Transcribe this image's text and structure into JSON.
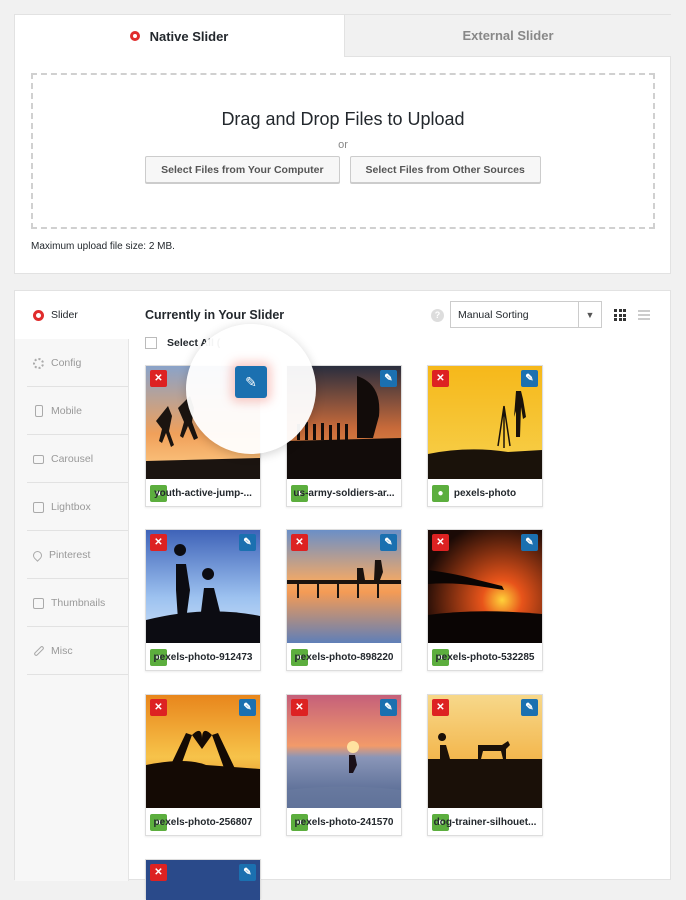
{
  "tabs": [
    {
      "label": "Native Slider",
      "active": true
    },
    {
      "label": "External Slider",
      "active": false
    }
  ],
  "upload": {
    "title": "Drag and Drop Files to Upload",
    "or": "or",
    "btn_computer": "Select Files from Your Computer",
    "btn_other": "Select Files from Other Sources",
    "max_size": "Maximum upload file size: 2 MB."
  },
  "sidebar": {
    "items": [
      {
        "label": "Slider",
        "icon": "slider-icon"
      },
      {
        "label": "Config",
        "icon": "gear-icon"
      },
      {
        "label": "Mobile",
        "icon": "mobile-icon"
      },
      {
        "label": "Carousel",
        "icon": "carousel-icon"
      },
      {
        "label": "Lightbox",
        "icon": "lightbox-icon"
      },
      {
        "label": "Pinterest",
        "icon": "pinterest-icon"
      },
      {
        "label": "Thumbnails",
        "icon": "thumbnails-icon"
      },
      {
        "label": "Misc",
        "icon": "wrench-icon"
      }
    ]
  },
  "main": {
    "title": "Currently in Your Slider",
    "help": "?",
    "sort_value": "Manual Sorting",
    "select_all": "Select All ("
  },
  "images": [
    {
      "caption": "youth-active-jump-..."
    },
    {
      "caption": "us-army-soldiers-ar..."
    },
    {
      "caption": "pexels-photo"
    },
    {
      "caption": "pexels-photo-912473"
    },
    {
      "caption": "pexels-photo-898220"
    },
    {
      "caption": "pexels-photo-532285"
    },
    {
      "caption": "pexels-photo-256807"
    },
    {
      "caption": "pexels-photo-241570"
    },
    {
      "caption": "dog-trainer-silhouet..."
    }
  ],
  "colors": {
    "accent_red": "#dd2222",
    "edit_blue": "#1b70b0",
    "view_green": "#5cae3e"
  }
}
